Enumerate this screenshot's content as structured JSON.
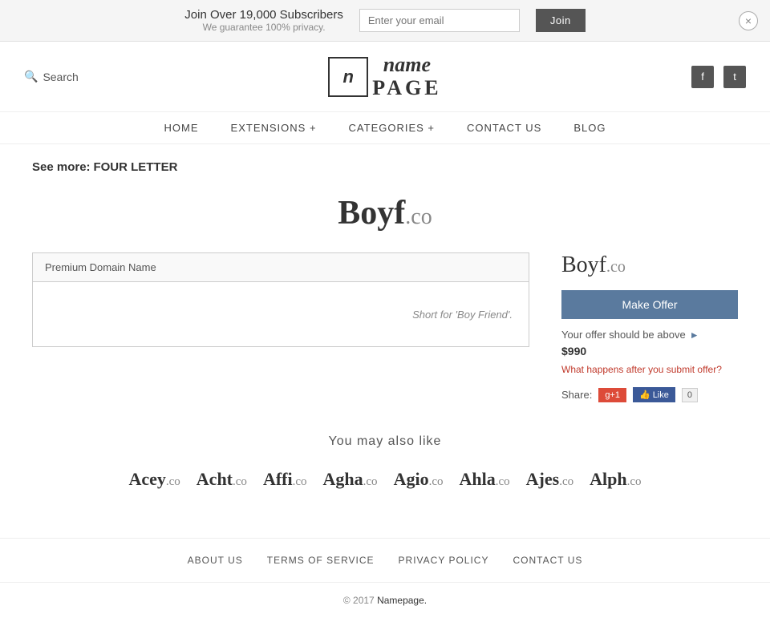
{
  "banner": {
    "main_text": "Join Over 19,000 Subscribers",
    "sub_text": "We guarantee 100% privacy.",
    "email_placeholder": "Enter your email",
    "join_label": "Join",
    "close_label": "×"
  },
  "header": {
    "search_label": "Search",
    "logo_icon": "n",
    "logo_name_word": "name",
    "logo_page_word": "PAGE",
    "social": {
      "facebook_label": "f",
      "twitter_label": "t"
    }
  },
  "nav": {
    "items": [
      {
        "label": "HOME"
      },
      {
        "label": "EXTENSIONS +"
      },
      {
        "label": "CATEGORIES +"
      },
      {
        "label": "CONTACT  US"
      },
      {
        "label": "BLOG"
      }
    ]
  },
  "see_more": {
    "prefix": "See more:",
    "text": "FOUR LETTER"
  },
  "domain": {
    "name": "Boyf",
    "tld": ".co",
    "card_header": "Premium Domain Name",
    "card_description": "Short for 'Boy Friend'.",
    "offer": {
      "make_offer_label": "Make Offer",
      "price_prefix": "Your offer should be above",
      "price": "$990",
      "what_happens_label": "What happens after you submit offer?",
      "share_label": "Share:",
      "gplus_label": "g+1",
      "fb_like_label": "Like",
      "fb_count": "0"
    }
  },
  "also_like": {
    "title": "You may also like",
    "domains": [
      {
        "name": "Acey",
        "tld": ".co"
      },
      {
        "name": "Acht",
        "tld": ".co"
      },
      {
        "name": "Affi",
        "tld": ".co"
      },
      {
        "name": "Agha",
        "tld": ".co"
      },
      {
        "name": "Agio",
        "tld": ".co"
      },
      {
        "name": "Ahla",
        "tld": ".co"
      },
      {
        "name": "Ajes",
        "tld": ".co"
      },
      {
        "name": "Alph",
        "tld": ".co"
      }
    ]
  },
  "footer": {
    "links": [
      {
        "label": "ABOUT  US"
      },
      {
        "label": "TERMS  OF  SERVICE"
      },
      {
        "label": "PRIVACY  POLICY"
      },
      {
        "label": "CONTACT  US"
      }
    ],
    "copyright": "© 2017",
    "brand": "Namepage.",
    "brand_url": "#"
  }
}
